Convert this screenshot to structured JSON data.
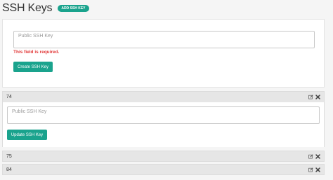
{
  "header": {
    "title": "SSH Keys",
    "add_button": "ADD SSH KEY"
  },
  "new_key": {
    "textarea_placeholder": "Public SSH Key",
    "textarea_value": "",
    "error": "This field is required.",
    "create_button": "Create SSH Key"
  },
  "keys": [
    {
      "name": "74",
      "expanded": true,
      "textarea_placeholder": "Public SSH Key",
      "update_button": "Update SSH Key"
    },
    {
      "name": "75",
      "expanded": false
    },
    {
      "name": "84",
      "expanded": false
    }
  ],
  "icons": {
    "edit": "edit-icon",
    "delete": "delete-icon"
  },
  "colors": {
    "accent": "#1aa38d",
    "error": "#e23b3b"
  }
}
